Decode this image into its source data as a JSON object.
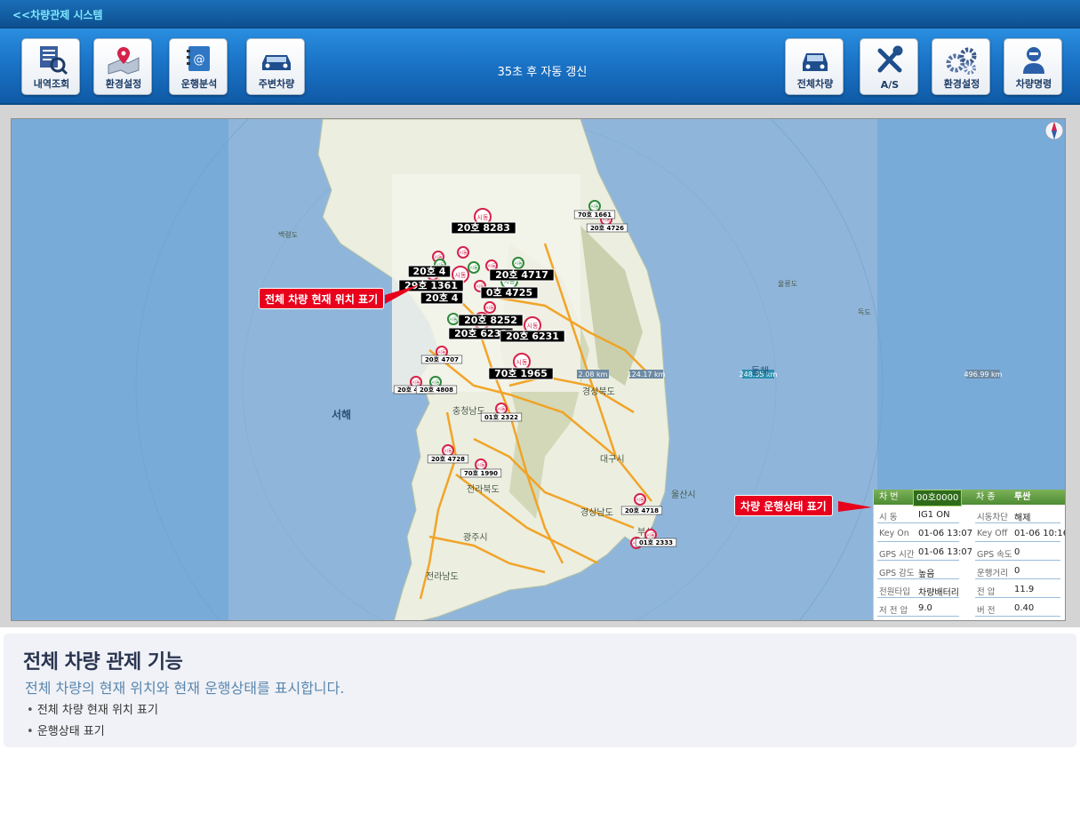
{
  "app": {
    "title": "<<차량관제 시스템"
  },
  "toolbar": {
    "left_buttons": [
      {
        "label": "내역조회",
        "icon": "history-search-icon"
      },
      {
        "label": "환경설정",
        "icon": "map-location-icon"
      },
      {
        "label": "운행분석",
        "icon": "address-book-icon"
      },
      {
        "label": "주변차량",
        "icon": "car-icon"
      }
    ],
    "refresh_text": "35초 후 자동 갱신",
    "right_buttons": [
      {
        "label": "전체차량",
        "icon": "car-front-icon"
      },
      {
        "label": "A/S",
        "icon": "tools-icon"
      },
      {
        "label": "환경설정",
        "icon": "gears-icon"
      },
      {
        "label": "차량명령",
        "icon": "person-command-icon"
      }
    ]
  },
  "map": {
    "sea_labels": {
      "west": "서해",
      "east": "동해"
    },
    "place_labels": [
      "경상북도",
      "충청남도",
      "대구시",
      "전라북도",
      "경상남도",
      "광주시",
      "전라남도",
      "울산시",
      "부산",
      "백령도",
      "울릉도",
      "독도"
    ],
    "scale_labels": [
      "2.08 km",
      "124.17 km",
      "248.35 km",
      "496.99 km"
    ],
    "marker_text": "시동",
    "vehicle_labels": [
      "20호 8283",
      "70호 1661",
      "20호 4726",
      "20호 4",
      "20호 4717",
      "29호 1361",
      "20호 4",
      "0호 4725",
      "20호 8252",
      "20호 6233",
      "20호 6231",
      "20호 4707",
      "70호 1965",
      "20호 4741",
      "20호 4808",
      "01호 2322",
      "20호 4728",
      "70호 1990",
      "20호 4718",
      "01호 2333"
    ]
  },
  "callouts": {
    "all_vehicles": "전체 차량 현재 위치 표기",
    "driving_status": "차량 운행상태 표기"
  },
  "vehicle_panel": {
    "header": {
      "plate_label": "차 번",
      "plate": "00호0000",
      "type_label": "차 종",
      "type": "투싼"
    },
    "rows": [
      {
        "k1": "시 동",
        "v1": "IG1 ON",
        "k2": "시동차단",
        "v2": "해제"
      },
      {
        "k1": "Key On",
        "v1": "01-06 13:07",
        "k2": "Key Off",
        "v2": "01-06 10:16"
      },
      {
        "k1": "GPS 시간",
        "v1": "01-06 13:07",
        "k2": "GPS 속도",
        "v2": "0"
      },
      {
        "k1": "GPS 감도",
        "v1": "높음",
        "k2": "운행거리",
        "v2": "0"
      },
      {
        "k1": "전원타입",
        "v1": "차량배터리",
        "k2": "전 압",
        "v2": "11.9"
      },
      {
        "k1": "저 전 압",
        "v1": "9.0",
        "k2": "버 전",
        "v2": "0.40"
      }
    ]
  },
  "info": {
    "title": "전체 차량 관제 기능",
    "subtitle": "전체 차량의 현재 위치와 현재 운행상태를 표시합니다.",
    "bullets": [
      "전체 차량 현재 위치 표기",
      "운행상태 표기"
    ]
  },
  "colors": {
    "callout": "#e8001c",
    "marker_red": "#d6224a",
    "marker_green": "#2e8a3a",
    "road": "#f2a11f",
    "land": "#eef0e2",
    "sea": "#74a6d4"
  }
}
